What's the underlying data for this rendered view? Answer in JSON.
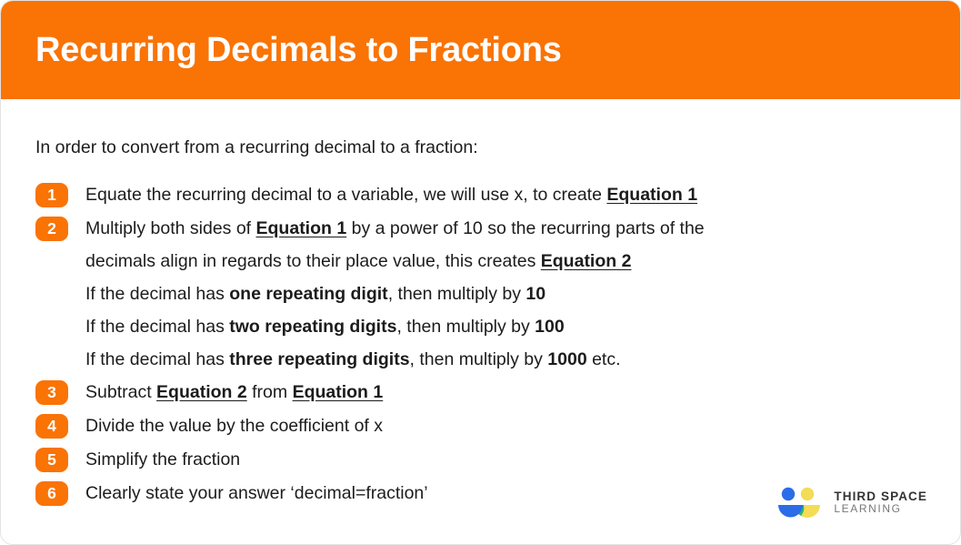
{
  "header": {
    "title": "Recurring Decimals to Fractions",
    "background_color": "#FA7305",
    "title_color": "#FFFFFF"
  },
  "body": {
    "intro": "In order to convert from a recurring decimal to a fraction:",
    "text_color": "#1C1C1C",
    "badge_color": "#FA7305"
  },
  "steps": [
    {
      "number": "1",
      "lines": [
        [
          {
            "text": "Equate the recurring decimal to a variable, we will use x, to create ",
            "style": "normal"
          },
          {
            "text": "Equation 1",
            "style": "bold-underline"
          }
        ]
      ]
    },
    {
      "number": "2",
      "lines": [
        [
          {
            "text": "Multiply both sides of ",
            "style": "normal"
          },
          {
            "text": "Equation 1",
            "style": "bold-underline"
          },
          {
            "text": " by a power of 10 so the recurring parts of the",
            "style": "normal"
          }
        ],
        [
          {
            "text": "decimals align in regards to their place value, this creates ",
            "style": "normal"
          },
          {
            "text": "Equation 2",
            "style": "bold-underline"
          }
        ],
        [
          {
            "text": "If the decimal has ",
            "style": "normal"
          },
          {
            "text": "one repeating digit",
            "style": "bold"
          },
          {
            "text": ", then multiply by ",
            "style": "normal"
          },
          {
            "text": "10",
            "style": "bold"
          }
        ],
        [
          {
            "text": "If the decimal has ",
            "style": "normal"
          },
          {
            "text": "two repeating digits",
            "style": "bold"
          },
          {
            "text": ", then multiply by ",
            "style": "normal"
          },
          {
            "text": "100",
            "style": "bold"
          }
        ],
        [
          {
            "text": "If the decimal has ",
            "style": "normal"
          },
          {
            "text": "three repeating digits",
            "style": "bold"
          },
          {
            "text": ", then multiply by ",
            "style": "normal"
          },
          {
            "text": "1000",
            "style": "bold"
          },
          {
            "text": " etc.",
            "style": "normal"
          }
        ]
      ]
    },
    {
      "number": "3",
      "lines": [
        [
          {
            "text": "Subtract ",
            "style": "normal"
          },
          {
            "text": "Equation 2",
            "style": "bold-underline"
          },
          {
            "text": " from ",
            "style": "normal"
          },
          {
            "text": "Equation 1",
            "style": "bold-underline"
          }
        ]
      ]
    },
    {
      "number": "4",
      "lines": [
        [
          {
            "text": "Divide the value by the coefficient of x",
            "style": "normal"
          }
        ]
      ]
    },
    {
      "number": "5",
      "lines": [
        [
          {
            "text": "Simplify the fraction",
            "style": "normal"
          }
        ]
      ]
    },
    {
      "number": "6",
      "lines": [
        [
          {
            "text": "Clearly state your answer ‘decimal=fraction’",
            "style": "normal"
          }
        ]
      ]
    }
  ],
  "logo": {
    "line1": "THIRD SPACE",
    "line2": "LEARNING",
    "blue": "#2B6CE8",
    "yellow": "#F3DC56",
    "green": "#2BB673",
    "icon_name": "third-space-learning-logo"
  }
}
